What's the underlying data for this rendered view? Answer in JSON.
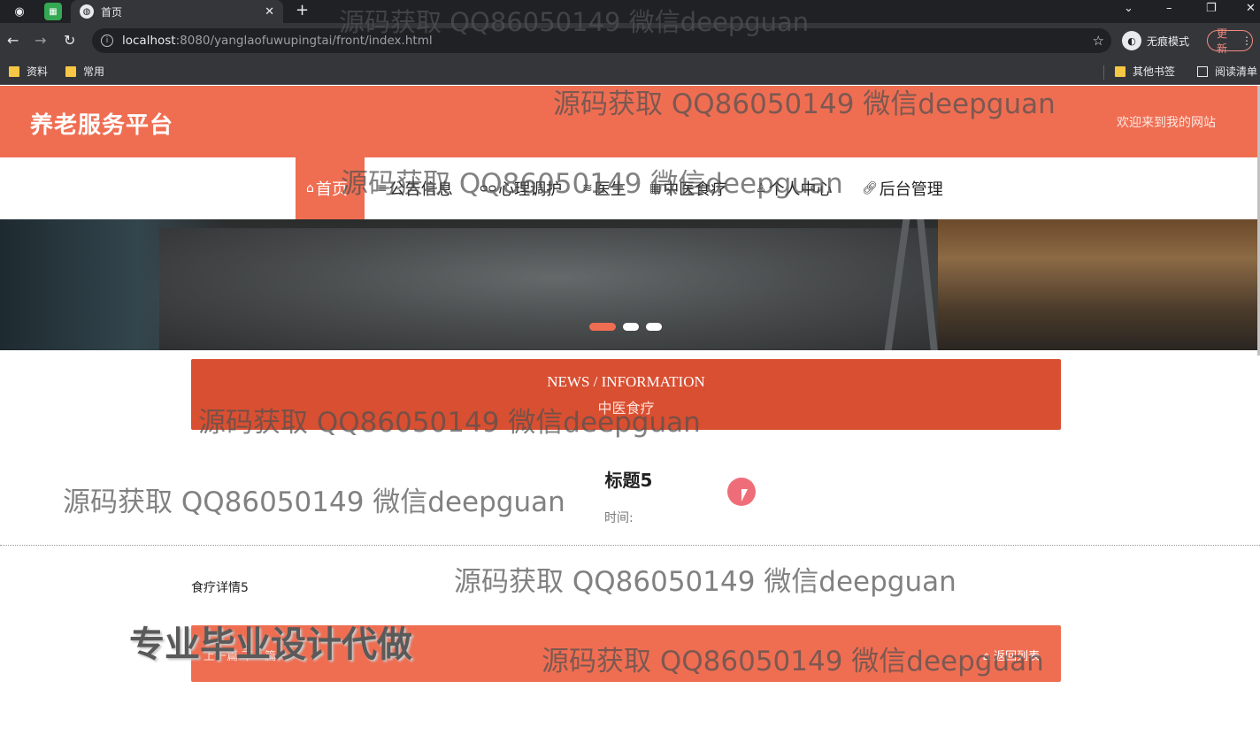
{
  "browser": {
    "tab_title": "首页",
    "url_host": "localhost",
    "url_rest": ":8080/yanglaofuwupingtai/front/index.html",
    "profile_label": "无痕模式",
    "update_label": "更新",
    "bookmarks": [
      "资料",
      "常用"
    ],
    "other_bookmarks": "其他书签",
    "reading_list": "阅读清单"
  },
  "site": {
    "title": "养老服务平台",
    "welcome": "欢迎来到我的网站"
  },
  "nav": {
    "items": [
      {
        "label": "首页",
        "icon": "home-icon",
        "active": true
      },
      {
        "label": "公告信息",
        "icon": "list-icon"
      },
      {
        "label": "心理调护",
        "icon": "glasses-icon"
      },
      {
        "label": "医生",
        "icon": "stack-icon"
      },
      {
        "label": "中医食疗",
        "icon": "grid-icon"
      },
      {
        "label": "个人中心",
        "icon": "user-icon"
      },
      {
        "label": "后台管理",
        "icon": "link-icon"
      }
    ]
  },
  "carousel": {
    "slides": 3,
    "active_index": 0
  },
  "news": {
    "heading_en": "NEWS / INFORMATION",
    "heading_cn": "中医食疗"
  },
  "article": {
    "title": "标题5",
    "time_label": "时间:",
    "body": "食疗详情5"
  },
  "footer": {
    "prev_next": "上一篇  下一篇",
    "back_label": "返回列表"
  },
  "overlays": {
    "watermark": "源码获取 QQ86050149 微信deepguan",
    "ad": "专业毕业设计代做"
  },
  "colors": {
    "primary": "#ef6e52",
    "news_bar": "#d94f31",
    "browser_dark": "#202124"
  }
}
